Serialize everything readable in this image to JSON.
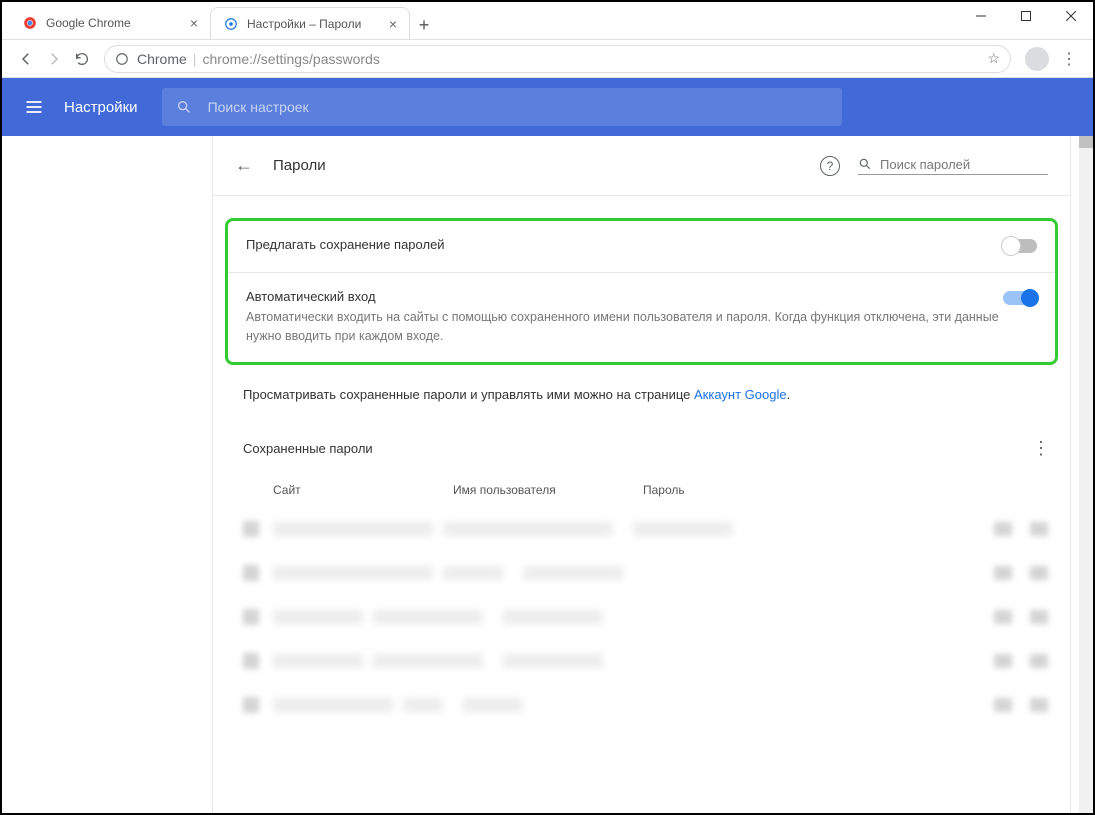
{
  "window": {
    "tabs": [
      {
        "title": "Google Chrome",
        "active": false
      },
      {
        "title": "Настройки – Пароли",
        "active": true
      }
    ]
  },
  "toolbar": {
    "secure_label": "Chrome",
    "url": "chrome://settings/passwords"
  },
  "header": {
    "title": "Настройки",
    "search_placeholder": "Поиск настроек"
  },
  "page": {
    "back_title": "Пароли",
    "pwd_search_placeholder": "Поиск паролей"
  },
  "settings": {
    "offer_save_label": "Предлагать сохранение паролей",
    "auto_signin_label": "Автоматический вход",
    "auto_signin_desc": "Автоматически входить на сайты с помощью сохраненного имени пользователя и пароля. Когда функция отключена, эти данные нужно вводить при каждом входе."
  },
  "info": {
    "text": "Просматривать сохраненные пароли и управлять ими можно на странице ",
    "link": "Аккаунт Google",
    "suffix": "."
  },
  "saved": {
    "header": "Сохраненные пароли",
    "col_site": "Сайт",
    "col_user": "Имя пользователя",
    "col_pass": "Пароль"
  }
}
